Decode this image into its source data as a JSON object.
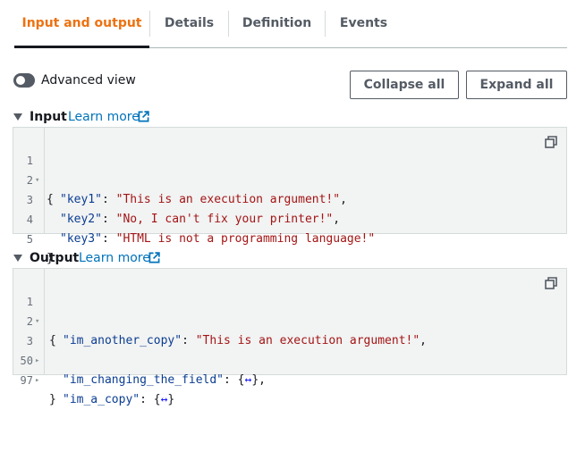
{
  "tabs": [
    {
      "label": "Input and output",
      "active": true
    },
    {
      "label": "Details",
      "active": false
    },
    {
      "label": "Definition",
      "active": false
    },
    {
      "label": "Events",
      "active": false
    }
  ],
  "toolbar": {
    "advanced_view_label": "Advanced view",
    "advanced_view_on": false,
    "collapse_all_label": "Collapse all",
    "expand_all_label": "Expand all"
  },
  "input": {
    "title": "Input",
    "learn_more": "Learn more",
    "lines": [
      {
        "num": "1",
        "fold": "▾",
        "text": "{"
      },
      {
        "num": "2",
        "fold": "",
        "key": "\"key1\"",
        "sep": ": ",
        "value": "\"This is an execution argument!\"",
        "end": ","
      },
      {
        "num": "3",
        "fold": "",
        "key": "\"key2\"",
        "sep": ": ",
        "value": "\"No, I can't fix your printer!\"",
        "end": ","
      },
      {
        "num": "4",
        "fold": "",
        "key": "\"key3\"",
        "sep": ": ",
        "value": "\"HTML is not a programming language!\"",
        "end": ""
      },
      {
        "num": "5",
        "fold": "",
        "text": "}"
      }
    ]
  },
  "output": {
    "title": "Output",
    "learn_more": "Learn more",
    "lines": [
      {
        "num": "1",
        "fold": "▾",
        "text": "{"
      },
      {
        "num": "2",
        "fold": "",
        "key": "\"im_another_copy\"",
        "sep": ": ",
        "value": "\"This is an execution argument!\"",
        "end": ","
      },
      {
        "num": "3",
        "fold": "▸",
        "key": "\"im_changing_the_field\"",
        "sep": ": ",
        "open": "{",
        "collapsed": "↔",
        "close": "}",
        "end": ","
      },
      {
        "num": "50",
        "fold": "▸",
        "key": "\"im_a_copy\"",
        "sep": ": ",
        "open": "{",
        "collapsed": "↔",
        "close": "}",
        "end": ""
      },
      {
        "num": "97",
        "fold": "",
        "text": "}"
      }
    ]
  },
  "colors": {
    "accent": "#ec7211",
    "link": "#0073bb",
    "json_key": "#0a3d91",
    "json_string": "#a31515"
  }
}
